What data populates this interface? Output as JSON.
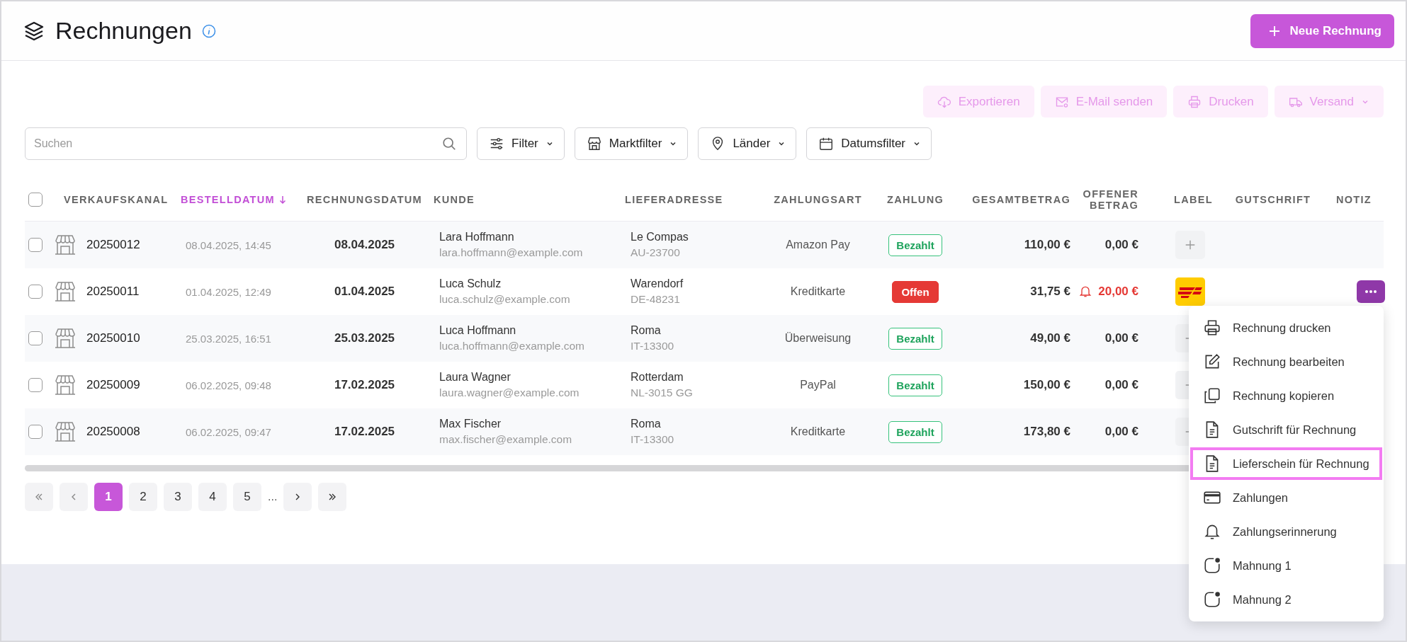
{
  "page": {
    "title": "Rechnungen",
    "new_button": "Neue Rechnung"
  },
  "actions": [
    {
      "label": "Exportieren",
      "kind": "export",
      "disabled": true,
      "dropdown": false
    },
    {
      "label": "E-Mail senden",
      "kind": "mail",
      "disabled": true,
      "dropdown": false
    },
    {
      "label": "Drucken",
      "kind": "print",
      "disabled": true,
      "dropdown": false
    },
    {
      "label": "Versand",
      "kind": "shipping",
      "disabled": true,
      "dropdown": true
    }
  ],
  "search": {
    "placeholder": "Suchen"
  },
  "filters": [
    {
      "label": "Filter",
      "kind": "filter"
    },
    {
      "label": "Marktfilter",
      "kind": "market"
    },
    {
      "label": "Länder",
      "kind": "location"
    },
    {
      "label": "Datumsfilter",
      "kind": "date"
    }
  ],
  "table": {
    "all_checked": false,
    "columns": [
      {
        "label": "VERKAUFSKANAL",
        "sorted": false
      },
      {
        "label": "BESTELLDATUM",
        "sorted": true
      },
      {
        "label": "RECHNUNGSDATUM",
        "sorted": false
      },
      {
        "label": "KUNDE",
        "sorted": false
      },
      {
        "label": "LIEFERADRESSE",
        "sorted": false
      },
      {
        "label": "ZAHLUNGSART",
        "sorted": false
      },
      {
        "label": "ZAHLUNG",
        "sorted": false
      },
      {
        "label": "GESAMTBETRAG",
        "sorted": false
      },
      {
        "label": "OFFENER BETRAG",
        "sorted": false
      },
      {
        "label": "LABEL",
        "sorted": false
      },
      {
        "label": "GUTSCHRIFT",
        "sorted": false
      },
      {
        "label": "NOTIZ",
        "sorted": false
      }
    ],
    "rows": [
      {
        "checked": false,
        "number": "20250012",
        "order_date": "08.04.2025, 14:45",
        "invoice_date": "08.04.2025",
        "customer": "Lara Hoffmann",
        "email": "lara.hoffmann@example.com",
        "city": "Le Compas",
        "postal": "AU-23700",
        "payment_method": "Amazon Pay",
        "payment_status": "Bezahlt",
        "paid": true,
        "total": "110,00 €",
        "open_amount": "0,00 €",
        "overdue": false,
        "carrier_label": false,
        "menu_open": false
      },
      {
        "checked": false,
        "number": "20250011",
        "order_date": "01.04.2025, 12:49",
        "invoice_date": "01.04.2025",
        "customer": "Luca Schulz",
        "email": "luca.schulz@example.com",
        "city": "Warendorf",
        "postal": "DE-48231",
        "payment_method": "Kreditkarte",
        "payment_status": "Offen",
        "paid": false,
        "total": "31,75 €",
        "open_amount": "20,00 €",
        "overdue": true,
        "carrier_label": true,
        "menu_open": true
      },
      {
        "checked": false,
        "number": "20250010",
        "order_date": "25.03.2025, 16:51",
        "invoice_date": "25.03.2025",
        "customer": "Luca Hoffmann",
        "email": "luca.hoffmann@example.com",
        "city": "Roma",
        "postal": "IT-13300",
        "payment_method": "Überweisung",
        "payment_status": "Bezahlt",
        "paid": true,
        "total": "49,00 €",
        "open_amount": "0,00 €",
        "overdue": false,
        "carrier_label": false,
        "menu_open": false
      },
      {
        "checked": false,
        "number": "20250009",
        "order_date": "06.02.2025, 09:48",
        "invoice_date": "17.02.2025",
        "customer": "Laura Wagner",
        "email": "laura.wagner@example.com",
        "city": "Rotterdam",
        "postal": "NL-3015 GG",
        "payment_method": "PayPal",
        "payment_status": "Bezahlt",
        "paid": true,
        "total": "150,00 €",
        "open_amount": "0,00 €",
        "overdue": false,
        "carrier_label": false,
        "menu_open": false
      },
      {
        "checked": false,
        "number": "20250008",
        "order_date": "06.02.2025, 09:47",
        "invoice_date": "17.02.2025",
        "customer": "Max Fischer",
        "email": "max.fischer@example.com",
        "city": "Roma",
        "postal": "IT-13300",
        "payment_method": "Kreditkarte",
        "payment_status": "Bezahlt",
        "paid": true,
        "total": "173,80 €",
        "open_amount": "0,00 €",
        "overdue": false,
        "carrier_label": false,
        "menu_open": false
      }
    ]
  },
  "menu": {
    "items": [
      {
        "label": "Rechnung drucken",
        "kind": "print",
        "selected": false
      },
      {
        "label": "Rechnung bearbeiten",
        "kind": "edit",
        "selected": false
      },
      {
        "label": "Rechnung kopieren",
        "kind": "copy",
        "selected": false
      },
      {
        "label": "Gutschrift für Rechnung",
        "kind": "document",
        "selected": false
      },
      {
        "label": "Lieferschein für Rechnung",
        "kind": "document",
        "selected": true
      },
      {
        "label": "Zahlungen",
        "kind": "card",
        "selected": false
      },
      {
        "label": "Zahlungserinnerung",
        "kind": "bell",
        "selected": false
      },
      {
        "label": "Mahnung 1",
        "kind": "dunning",
        "selected": false
      },
      {
        "label": "Mahnung 2",
        "kind": "dunning",
        "selected": false
      }
    ]
  },
  "pagination": {
    "pages": [
      {
        "label": "1",
        "selected": true
      },
      {
        "label": "2",
        "selected": false
      },
      {
        "label": "3",
        "selected": false
      },
      {
        "label": "4",
        "selected": false
      },
      {
        "label": "5",
        "selected": false
      }
    ],
    "ellipsis": "..."
  }
}
